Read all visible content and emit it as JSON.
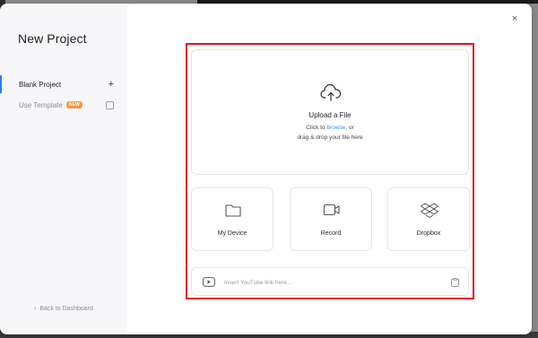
{
  "colors": {
    "accent": "#2b8ef0",
    "highlight_border": "#e0161d",
    "badge_bg": "#ef9b4a"
  },
  "sidebar": {
    "title": "New Project",
    "items": [
      {
        "label": "Blank Project",
        "icon": "plus-icon"
      },
      {
        "label": "Use Template",
        "badge": "NEW",
        "icon": "template-icon"
      }
    ],
    "back_label": "Back to Dashboard"
  },
  "upload": {
    "title": "Upload a File",
    "line1_prefix": "Click to ",
    "browse_link": "browse",
    "line1_suffix": ", or",
    "line2": "drag & drop your file here",
    "icon": "cloud-upload-icon"
  },
  "sources": [
    {
      "label": "My Device",
      "icon": "folder-icon"
    },
    {
      "label": "Record",
      "icon": "video-camera-icon"
    },
    {
      "label": "Dropbox",
      "icon": "dropbox-icon"
    }
  ],
  "youtube": {
    "placeholder": "Insert YouTube link here...",
    "value": "",
    "icon": "youtube-icon"
  },
  "close_glyph": "×"
}
